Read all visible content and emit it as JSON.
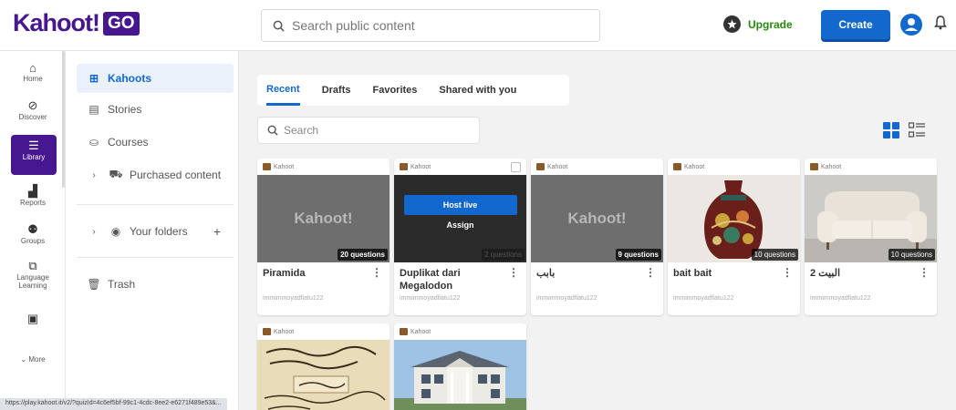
{
  "brand": {
    "logo_text": "Kahoot!",
    "logo_badge": "GO",
    "color_purple": "#46178f",
    "color_blue": "#1368ce"
  },
  "header": {
    "search_placeholder": "Search public content",
    "upgrade_label": "Upgrade",
    "create_label": "Create"
  },
  "rail": {
    "items": [
      {
        "label": "Home",
        "icon": "home-icon"
      },
      {
        "label": "Discover",
        "icon": "compass-icon"
      },
      {
        "label": "Library",
        "icon": "library-icon",
        "active": true
      },
      {
        "label": "Reports",
        "icon": "reports-icon"
      },
      {
        "label": "Groups",
        "icon": "groups-icon"
      },
      {
        "label": "Language Learning",
        "icon": "language-icon"
      },
      {
        "label": "",
        "icon": "marketplace-icon"
      },
      {
        "label": "More",
        "icon": "more-icon"
      }
    ]
  },
  "library": {
    "kahoots": "Kahoots",
    "stories": "Stories",
    "courses": "Courses",
    "purchased": "Purchased content",
    "folders": "Your folders",
    "folders_add": "+",
    "trash": "Trash"
  },
  "tabs": [
    "Recent",
    "Drafts",
    "Favorites",
    "Shared with you"
  ],
  "content_search_placeholder": "Search",
  "card_tag": "Kahoot",
  "cards": [
    {
      "title": "Piramida",
      "questions": "20 questions",
      "owner": "immimmoyadfiatu122",
      "thumb": "kahoot"
    },
    {
      "title": "Duplikat dari Megalodon",
      "questions": "2 questions",
      "owner": "immimmoyadfiatu122",
      "thumb": "hover",
      "host_live": "Host live",
      "assign": "Assign"
    },
    {
      "title": "بابب",
      "questions": "9 questions",
      "owner": "immimmoyadfiatu122",
      "thumb": "kahoot"
    },
    {
      "title": "bait bait",
      "questions": "10 questions",
      "owner": "immimmoyadfiatu122",
      "thumb": "vase"
    },
    {
      "title": "البيت 2",
      "questions": "10 questions",
      "owner": "immimmoyadfiatu122",
      "thumb": "sofa"
    },
    {
      "title": "",
      "questions": "",
      "owner": "",
      "thumb": "manuscript"
    },
    {
      "title": "",
      "questions": "",
      "owner": "",
      "thumb": "house"
    }
  ],
  "thumb_watermark": "Kahoot!",
  "statusbar_url": "https://play.kahoot.it/v2/?quizId=4c6ef5bf-99c1-4cdc-8ee2-e6271f489e53&..."
}
